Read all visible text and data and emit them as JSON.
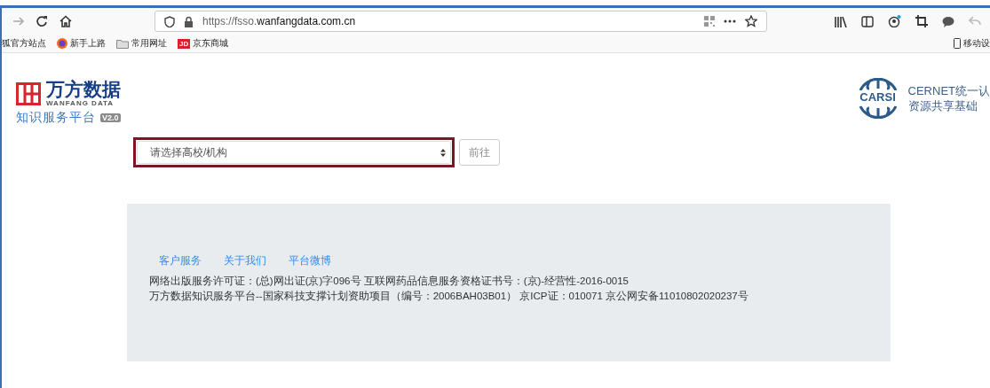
{
  "browser": {
    "url_prefix": "https://fsso.",
    "url_domain": "wanfangdata.com.cn",
    "bookmarks": [
      {
        "label": "狐官方站点",
        "kind": "plain"
      },
      {
        "label": "新手上路",
        "kind": "firefox"
      },
      {
        "label": "常用网址",
        "kind": "folder"
      },
      {
        "label": "京东商城",
        "kind": "jd",
        "badge": "JD"
      }
    ],
    "mobile_bookmark": "移动设"
  },
  "header": {
    "logo_title": "万方数据",
    "logo_subtitle": "WANFANG DATA",
    "platform": "知识服务平台",
    "version": "V2.0",
    "carsi_badge": "CARSI",
    "carsi_line1": "CERNET统一认",
    "carsi_line2": "资源共享基础"
  },
  "form": {
    "select_placeholder": "请选择高校/机构",
    "go_button": "前往"
  },
  "footer": {
    "links": [
      "客户服务",
      "关于我们",
      "平台微博"
    ],
    "lines": [
      "网络出版服务许可证：(总)网出证(京)字096号 互联网药品信息服务资格证书号：(京)-经营性-2016-0015",
      "万方数据知识服务平台--国家科技支撑计划资助项目（编号：2006BAH03B01） 京ICP证：010071 京公网安备11010802020237号"
    ]
  }
}
